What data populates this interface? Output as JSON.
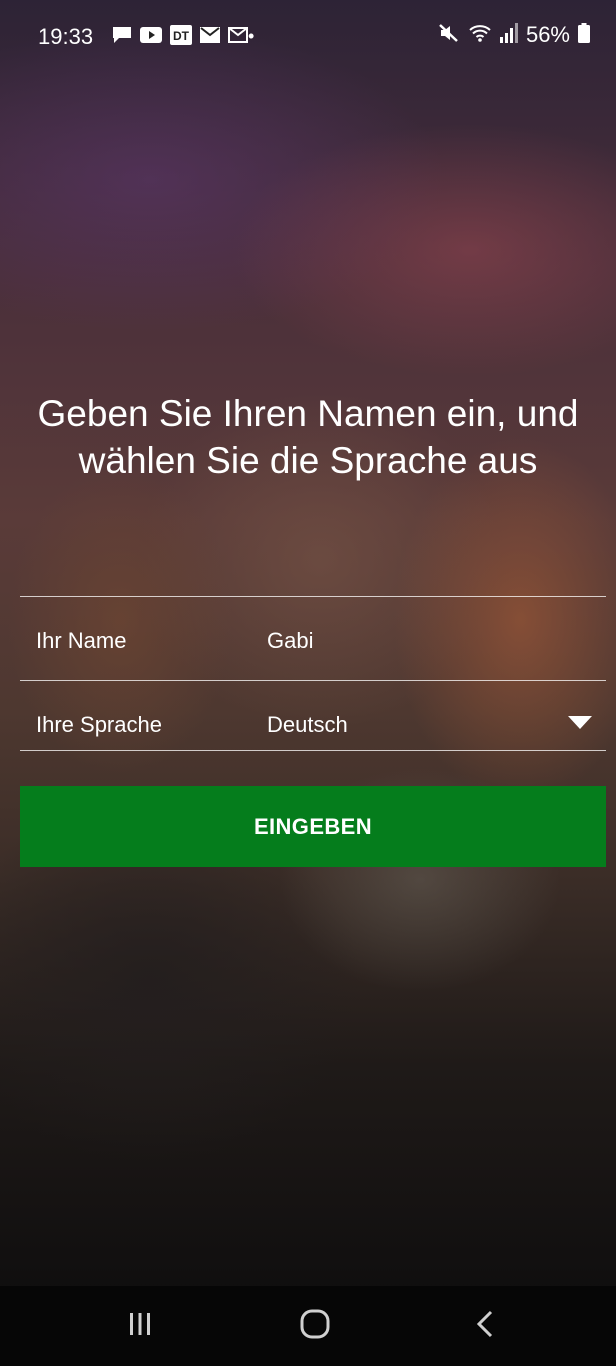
{
  "status_bar": {
    "time": "19:33",
    "notification_icons": [
      "chat-icon",
      "youtube-icon",
      "dt-app-icon",
      "mail-icon",
      "mail-outline-icon"
    ],
    "dot": "•",
    "right_icons": [
      "mute-icon",
      "wifi-icon",
      "signal-icon"
    ],
    "battery_percent": "56%"
  },
  "main": {
    "title": "Geben Sie Ihren Namen ein, und wählen Sie die Sprache aus"
  },
  "form": {
    "name_label": "Ihr Name",
    "name_value": "Gabi",
    "language_label": "Ihre Sprache",
    "language_value": "Deutsch",
    "submit_label": "EINGEBEN"
  },
  "nav_bar": {
    "buttons": [
      "recent-apps",
      "home",
      "back"
    ]
  },
  "colors": {
    "accent_button": "#057d1c",
    "text": "#ffffff"
  }
}
